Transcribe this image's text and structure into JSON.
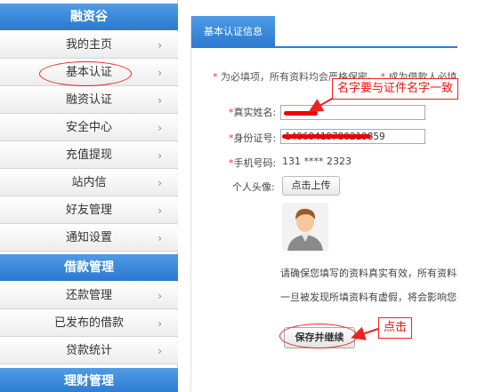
{
  "sidebar": {
    "section_financing": "融资谷",
    "items_financing": [
      {
        "label": "我的主页"
      },
      {
        "label": "基本认证"
      },
      {
        "label": "融资认证"
      },
      {
        "label": "安全中心"
      },
      {
        "label": "充值提现"
      },
      {
        "label": "站内信"
      },
      {
        "label": "好友管理"
      },
      {
        "label": "通知设置"
      }
    ],
    "section_loan": "借款管理",
    "items_loan": [
      {
        "label": "还款管理"
      },
      {
        "label": "已发布的借款"
      },
      {
        "label": "贷款统计"
      }
    ],
    "section_invest": "理财管理",
    "arrow_glyph": "›"
  },
  "main": {
    "tab_label": "基本认证信息",
    "notice_star1": "*",
    "notice_text1": "为必填项，所有资料均会严格保密。",
    "notice_star2": "*",
    "notice_text2": "成为借款人必填项",
    "form": {
      "name_star": "*",
      "name_label": "真实姓名:",
      "id_star": "*",
      "id_label": "身份证号:",
      "id_value": "14060419780219859",
      "phone_star": "*",
      "phone_label": "手机号码:",
      "phone_value": "131  ****  2323",
      "avatar_label": "个人头像:",
      "upload_label": "点击上传"
    },
    "para1": "请确保您填写的资料真实有效，所有资料将会",
    "para2": "一旦被发现所填资料有虚假，将会影响您在融",
    "save_label": "保存并继续"
  },
  "annotations": {
    "name_note": "名字要与证件名字一致",
    "click_note": "点击",
    "accent_color": "#e22222"
  },
  "colors": {
    "nav_blue": "#2b79cf",
    "tab_underline": "#2a7fd4",
    "required_star": "#e33333"
  }
}
